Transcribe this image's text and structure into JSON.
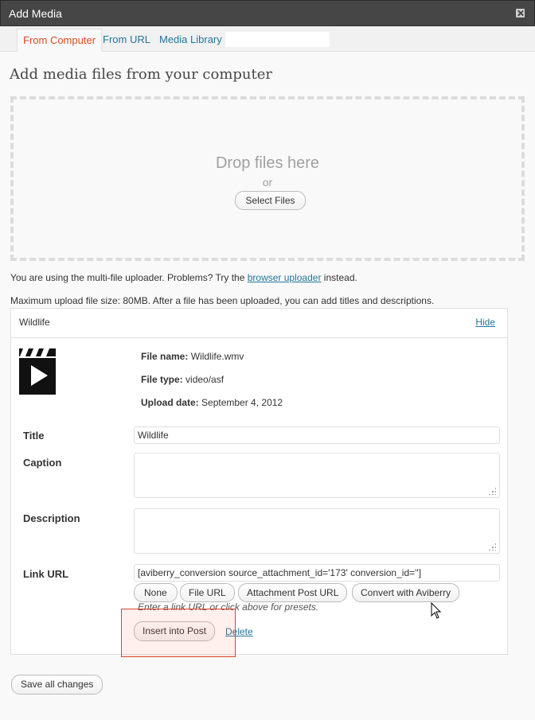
{
  "window": {
    "title": "Add Media"
  },
  "tabs": [
    {
      "label": "From Computer"
    },
    {
      "label": "From URL"
    },
    {
      "label": "Media Library"
    }
  ],
  "heading": "Add media files from your computer",
  "dropzone": {
    "drop_text": "Drop files here",
    "or_text": "or",
    "select_button": "Select Files"
  },
  "uploader_notice": {
    "prefix": "You are using the multi-file uploader. Problems? Try the",
    "link": "browser uploader",
    "suffix": "instead."
  },
  "max_size_text": "Maximum upload file size: 80MB. After a file has been uploaded, you can add titles and descriptions.",
  "item": {
    "name": "Wildlife",
    "hide_label": "Hide",
    "thumb_icon": "video-clapperboard-icon",
    "file_name_label": "File name:",
    "file_name": "Wildlife.wmv",
    "file_type_label": "File type:",
    "file_type": "video/asf",
    "upload_date_label": "Upload date:",
    "upload_date": "September 4, 2012",
    "title_label": "Title",
    "title_value": "Wildlife",
    "caption_label": "Caption",
    "caption_value": "",
    "description_label": "Description",
    "description_value": "",
    "link_url_label": "Link URL",
    "link_url_value": "[aviberry_conversion source_attachment_id='173' conversion_id='']",
    "link_buttons": {
      "none": "None",
      "file_url": "File URL",
      "attachment_post_url": "Attachment Post URL",
      "convert": "Convert with Aviberry"
    },
    "link_hint": "Enter a link URL or click above for presets.",
    "insert_button": "Insert into Post",
    "delete_label": "Delete"
  },
  "save_all_button": "Save all changes",
  "colors": {
    "titlebar": "#464646",
    "link": "#21759b",
    "active_tab": "#d54e21",
    "highlight_border": "#d9472b"
  }
}
